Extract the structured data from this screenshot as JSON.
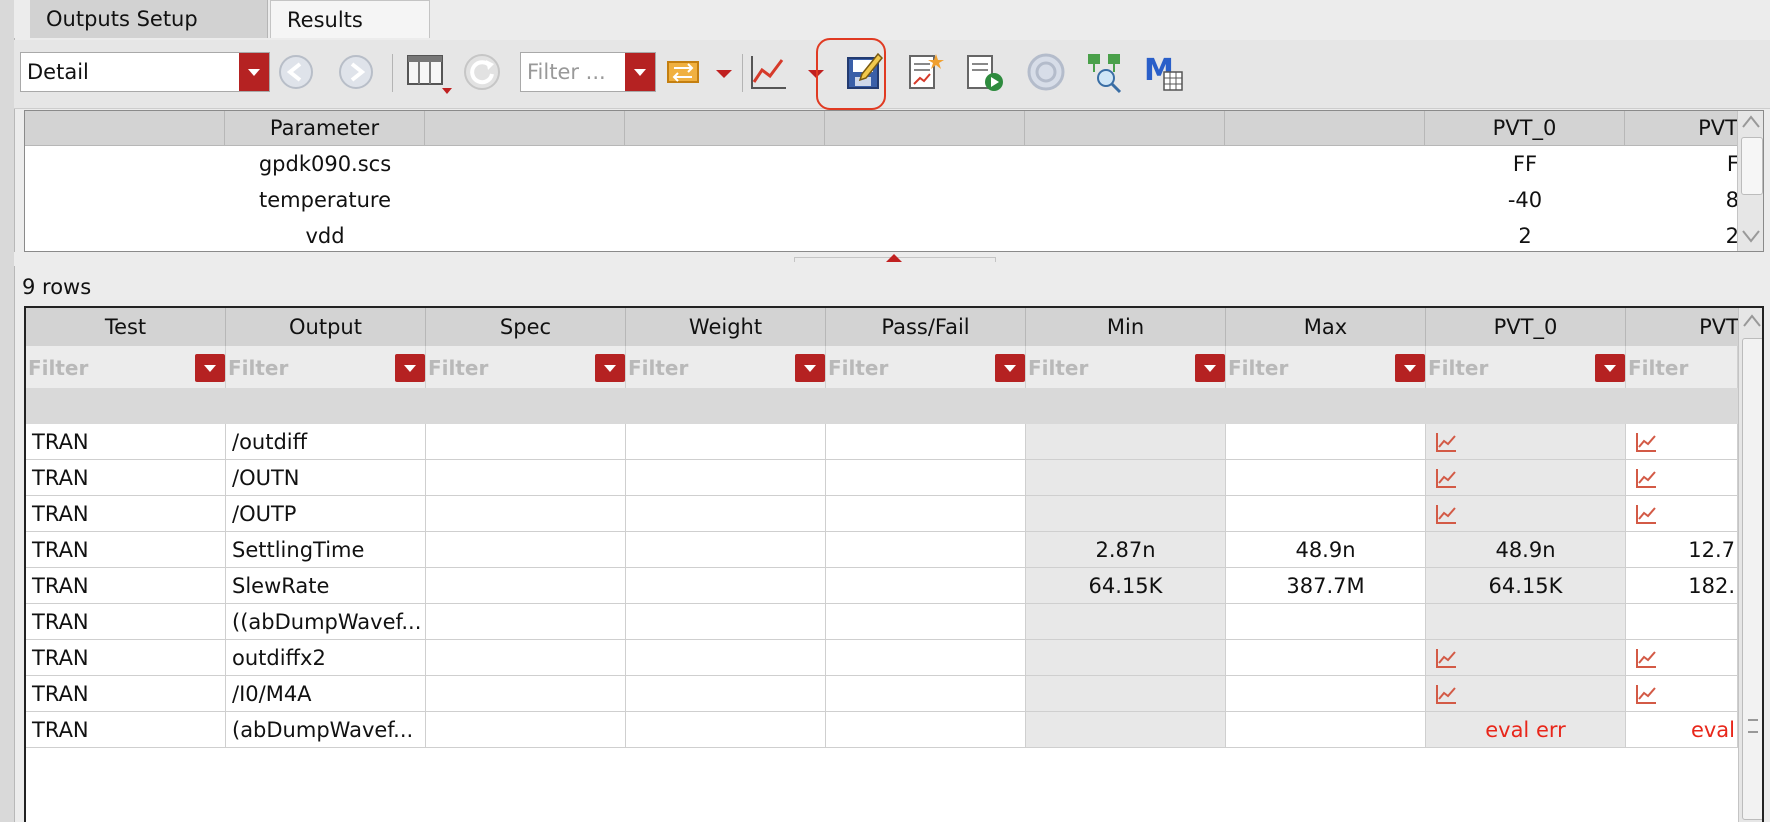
{
  "tabs": [
    {
      "label": "Outputs Setup",
      "active": false
    },
    {
      "label": "Results",
      "active": true
    }
  ],
  "toolbar": {
    "view_select": {
      "value": "Detail"
    },
    "filter_select": {
      "placeholder": "Filter ..."
    }
  },
  "upper_table": {
    "headers": [
      "",
      "Parameter",
      "",
      "",
      "",
      "",
      "",
      "PVT_0",
      "PVT"
    ],
    "rows": [
      {
        "parameter": "gpdk090.scs",
        "pvt0": "FF",
        "pvt1": "F"
      },
      {
        "parameter": "temperature",
        "pvt0": "-40",
        "pvt1": "8"
      },
      {
        "parameter": "vdd",
        "pvt0": "2",
        "pvt1": "2"
      }
    ]
  },
  "row_count": "9 rows",
  "results_table": {
    "headers": [
      "Test",
      "Output",
      "Spec",
      "Weight",
      "Pass/Fail",
      "Min",
      "Max",
      "PVT_0",
      "PVT"
    ],
    "filter_placeholder": "Filter",
    "rows": [
      {
        "test": "TRAN",
        "output": "/outdiff",
        "spec": "",
        "weight": "",
        "pass_fail": "",
        "min": "",
        "max": "",
        "pvt0": "wave",
        "pvt1": "wave"
      },
      {
        "test": "TRAN",
        "output": "/OUTN",
        "spec": "",
        "weight": "",
        "pass_fail": "",
        "min": "",
        "max": "",
        "pvt0": "wave",
        "pvt1": "wave"
      },
      {
        "test": "TRAN",
        "output": "/OUTP",
        "spec": "",
        "weight": "",
        "pass_fail": "",
        "min": "",
        "max": "",
        "pvt0": "wave",
        "pvt1": "wave"
      },
      {
        "test": "TRAN",
        "output": "SettlingTime",
        "spec": "",
        "weight": "",
        "pass_fail": "",
        "min": "2.87n",
        "max": "48.9n",
        "pvt0": "48.9n",
        "pvt1": "12.7"
      },
      {
        "test": "TRAN",
        "output": "SlewRate",
        "spec": "",
        "weight": "",
        "pass_fail": "",
        "min": "64.15K",
        "max": "387.7M",
        "pvt0": "64.15K",
        "pvt1": "182."
      },
      {
        "test": "TRAN",
        "output": "((abDumpWavef...",
        "spec": "",
        "weight": "",
        "pass_fail": "",
        "min": "",
        "max": "",
        "pvt0": "",
        "pvt1": ""
      },
      {
        "test": "TRAN",
        "output": "outdiffx2",
        "spec": "",
        "weight": "",
        "pass_fail": "",
        "min": "",
        "max": "",
        "pvt0": "wave",
        "pvt1": "wave"
      },
      {
        "test": "TRAN",
        "output": "/I0/M4A",
        "spec": "",
        "weight": "",
        "pass_fail": "",
        "min": "",
        "max": "",
        "pvt0": "wave",
        "pvt1": "wave"
      },
      {
        "test": "TRAN",
        "output": "(abDumpWavef...",
        "spec": "",
        "weight": "",
        "pass_fail": "",
        "min": "",
        "max": "",
        "pvt0": "eval err",
        "pvt1": "eval"
      }
    ]
  },
  "colors": {
    "accent_red": "#b52222",
    "error_text": "#e8261a",
    "highlight": "#e03a22"
  }
}
